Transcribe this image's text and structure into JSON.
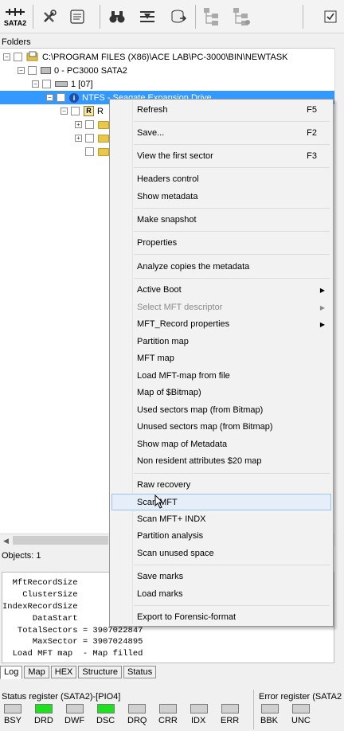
{
  "toolbar": {
    "sata_label": "SATA2",
    "icons": [
      "sata2-icon",
      "tools-icon",
      "scroll-icon",
      "binoculars-icon",
      "filter-icon",
      "disk-export-icon",
      "tree-icon-1",
      "tree-icon-2",
      "checklist-icon"
    ]
  },
  "folders": {
    "title": "Folders",
    "rows": [
      {
        "label": "C:\\PROGRAM FILES (X86)\\ACE LAB\\PC-3000\\BIN\\NEWTASK"
      },
      {
        "label": "0 - PC3000 SATA2"
      },
      {
        "label": "1 [07]"
      },
      {
        "label": "NTFS - Seagate Expansion Drive"
      },
      {
        "label": "R"
      }
    ]
  },
  "objects_label": "Objects: 1",
  "log": {
    "lines": [
      "  MftRecordSize",
      "    ClusterSize",
      "IndexRecordSize",
      "      DataStart",
      "   TotalSectors = 3907022847",
      "      MaxSector = 3907024895",
      "  Load MFT map  - Map filled"
    ]
  },
  "tabs": [
    "Log",
    "Map",
    "HEX",
    "Structure",
    "Status"
  ],
  "status_register": {
    "title": "Status register (SATA2)-[PIO4]",
    "leds": [
      {
        "label": "BSY",
        "on": false
      },
      {
        "label": "DRD",
        "on": true
      },
      {
        "label": "DWF",
        "on": false
      },
      {
        "label": "DSC",
        "on": true
      },
      {
        "label": "DRQ",
        "on": false
      },
      {
        "label": "CRR",
        "on": false
      },
      {
        "label": "IDX",
        "on": false
      },
      {
        "label": "ERR",
        "on": false
      }
    ]
  },
  "error_register": {
    "title": "Error register (SATA2",
    "leds": [
      {
        "label": "BBK",
        "on": false
      },
      {
        "label": "UNC",
        "on": false
      }
    ]
  },
  "context_menu": {
    "items": [
      {
        "label": "Refresh",
        "shortcut": "F5"
      },
      {
        "label": "Save...",
        "shortcut": "F2"
      },
      {
        "label": "View the first sector",
        "shortcut": "F3"
      },
      {
        "label": "Headers control"
      },
      {
        "label": "Show metadata"
      },
      {
        "label": "Make snapshot"
      },
      {
        "label": "Properties"
      },
      {
        "label": "Analyze copies the metadata"
      },
      {
        "label": "Active Boot",
        "submenu": true
      },
      {
        "label": "Select MFT descriptor",
        "submenu": true,
        "disabled": true
      },
      {
        "label": "MFT_Record properties",
        "submenu": true
      },
      {
        "label": "Partition map"
      },
      {
        "label": "MFT map"
      },
      {
        "label": "Load MFT-map from file"
      },
      {
        "label": "Map of $Bitmap)"
      },
      {
        "label": "Used sectors map (from Bitmap)"
      },
      {
        "label": "Unused sectors map (from Bitmap)"
      },
      {
        "label": "Show map of Metadata"
      },
      {
        "label": "Non resident attributes $20 map"
      },
      {
        "label": "Raw recovery"
      },
      {
        "label": "Scan MFT"
      },
      {
        "label": "Scan MFT+ INDX"
      },
      {
        "label": "Partition analysis"
      },
      {
        "label": "Scan unused space"
      },
      {
        "label": "Save marks"
      },
      {
        "label": "Load marks"
      },
      {
        "label": "Export to Forensic-format"
      }
    ]
  }
}
